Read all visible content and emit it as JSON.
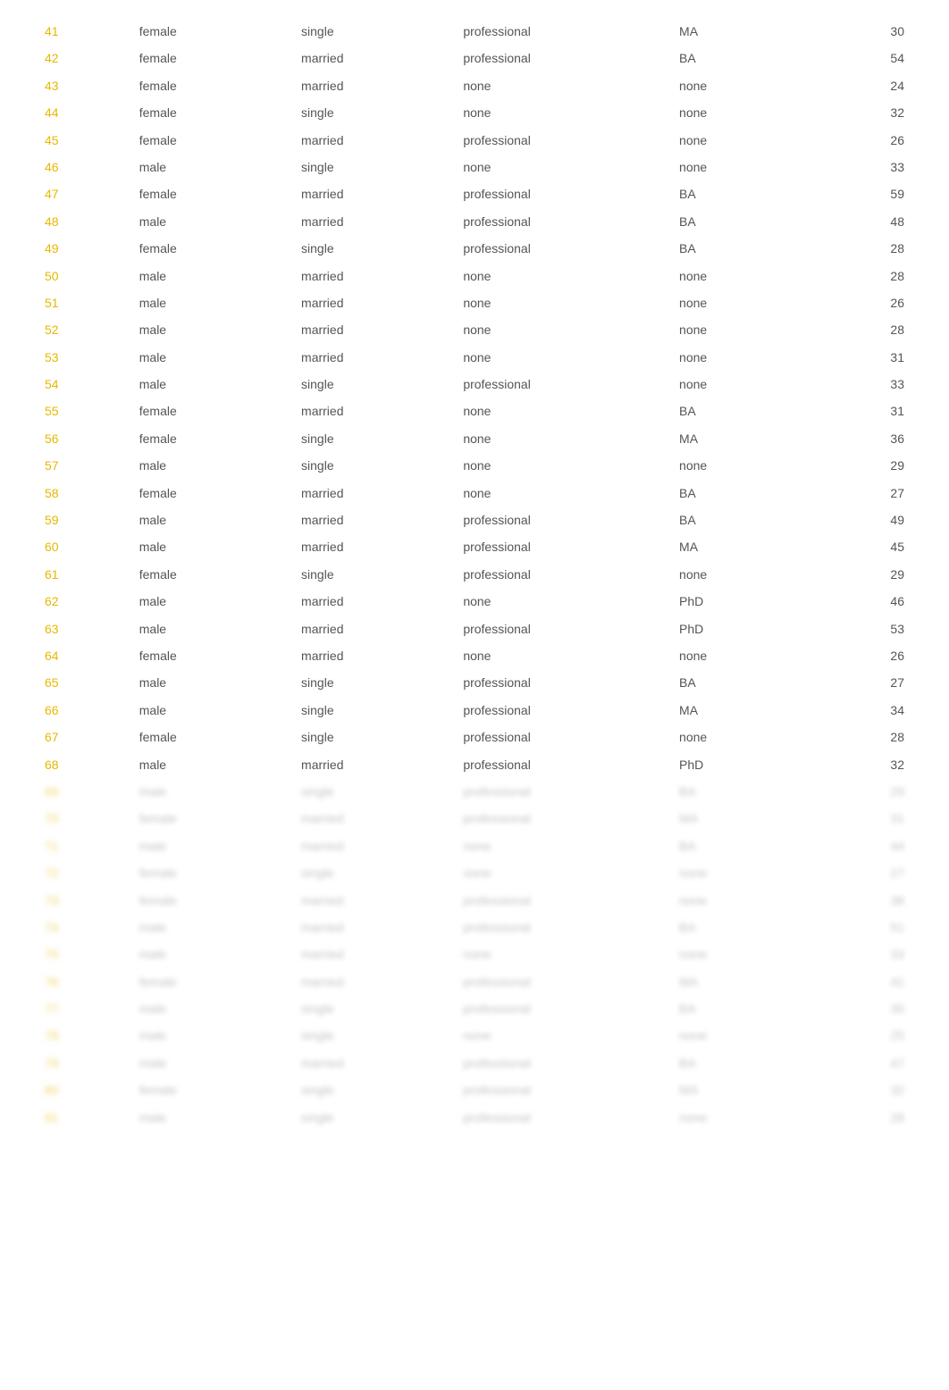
{
  "table": {
    "rows": [
      {
        "id": "41",
        "gender": "female",
        "marital": "single",
        "job": "professional",
        "edu": "MA",
        "age": "30"
      },
      {
        "id": "42",
        "gender": "female",
        "marital": "married",
        "job": "professional",
        "edu": "BA",
        "age": "54"
      },
      {
        "id": "43",
        "gender": "female",
        "marital": "married",
        "job": "none",
        "edu": "none",
        "age": "24"
      },
      {
        "id": "44",
        "gender": "female",
        "marital": "single",
        "job": "none",
        "edu": "none",
        "age": "32"
      },
      {
        "id": "45",
        "gender": "female",
        "marital": "married",
        "job": "professional",
        "edu": "none",
        "age": "26"
      },
      {
        "id": "46",
        "gender": "male",
        "marital": "single",
        "job": "none",
        "edu": "none",
        "age": "33"
      },
      {
        "id": "47",
        "gender": "female",
        "marital": "married",
        "job": "professional",
        "edu": "BA",
        "age": "59"
      },
      {
        "id": "48",
        "gender": "male",
        "marital": "married",
        "job": "professional",
        "edu": "BA",
        "age": "48"
      },
      {
        "id": "49",
        "gender": "female",
        "marital": "single",
        "job": "professional",
        "edu": "BA",
        "age": "28"
      },
      {
        "id": "50",
        "gender": "male",
        "marital": "married",
        "job": "none",
        "edu": "none",
        "age": "28"
      },
      {
        "id": "51",
        "gender": "male",
        "marital": "married",
        "job": "none",
        "edu": "none",
        "age": "26"
      },
      {
        "id": "52",
        "gender": "male",
        "marital": "married",
        "job": "none",
        "edu": "none",
        "age": "28"
      },
      {
        "id": "53",
        "gender": "male",
        "marital": "married",
        "job": "none",
        "edu": "none",
        "age": "31"
      },
      {
        "id": "54",
        "gender": "male",
        "marital": "single",
        "job": "professional",
        "edu": "none",
        "age": "33"
      },
      {
        "id": "55",
        "gender": "female",
        "marital": "married",
        "job": "none",
        "edu": "BA",
        "age": "31"
      },
      {
        "id": "56",
        "gender": "female",
        "marital": "single",
        "job": "none",
        "edu": "MA",
        "age": "36"
      },
      {
        "id": "57",
        "gender": "male",
        "marital": "single",
        "job": "none",
        "edu": "none",
        "age": "29"
      },
      {
        "id": "58",
        "gender": "female",
        "marital": "married",
        "job": "none",
        "edu": "BA",
        "age": "27"
      },
      {
        "id": "59",
        "gender": "male",
        "marital": "married",
        "job": "professional",
        "edu": "BA",
        "age": "49"
      },
      {
        "id": "60",
        "gender": "male",
        "marital": "married",
        "job": "professional",
        "edu": "MA",
        "age": "45"
      },
      {
        "id": "61",
        "gender": "female",
        "marital": "single",
        "job": "professional",
        "edu": "none",
        "age": "29"
      },
      {
        "id": "62",
        "gender": "male",
        "marital": "married",
        "job": "none",
        "edu": "PhD",
        "age": "46"
      },
      {
        "id": "63",
        "gender": "male",
        "marital": "married",
        "job": "professional",
        "edu": "PhD",
        "age": "53"
      },
      {
        "id": "64",
        "gender": "female",
        "marital": "married",
        "job": "none",
        "edu": "none",
        "age": "26"
      },
      {
        "id": "65",
        "gender": "male",
        "marital": "single",
        "job": "professional",
        "edu": "BA",
        "age": "27"
      },
      {
        "id": "66",
        "gender": "male",
        "marital": "single",
        "job": "professional",
        "edu": "MA",
        "age": "34"
      },
      {
        "id": "67",
        "gender": "female",
        "marital": "single",
        "job": "professional",
        "edu": "none",
        "age": "28"
      },
      {
        "id": "68",
        "gender": "male",
        "marital": "married",
        "job": "professional",
        "edu": "PhD",
        "age": "32"
      }
    ],
    "blurred_rows": [
      {
        "id": "69",
        "gender": "male",
        "marital": "single",
        "job": "professional",
        "edu": "BA",
        "age": "29"
      },
      {
        "id": "70",
        "gender": "female",
        "marital": "married",
        "job": "professional",
        "edu": "MA",
        "age": "31"
      },
      {
        "id": "71",
        "gender": "male",
        "marital": "married",
        "job": "none",
        "edu": "BA",
        "age": "44"
      },
      {
        "id": "72",
        "gender": "female",
        "marital": "single",
        "job": "none",
        "edu": "none",
        "age": "27"
      },
      {
        "id": "73",
        "gender": "female",
        "marital": "married",
        "job": "professional",
        "edu": "none",
        "age": "38"
      },
      {
        "id": "74",
        "gender": "male",
        "marital": "married",
        "job": "professional",
        "edu": "BA",
        "age": "51"
      },
      {
        "id": "75",
        "gender": "male",
        "marital": "married",
        "job": "none",
        "edu": "none",
        "age": "33"
      },
      {
        "id": "76",
        "gender": "female",
        "marital": "married",
        "job": "professional",
        "edu": "MA",
        "age": "41"
      },
      {
        "id": "77",
        "gender": "male",
        "marital": "single",
        "job": "professional",
        "edu": "BA",
        "age": "30"
      },
      {
        "id": "78",
        "gender": "male",
        "marital": "single",
        "job": "none",
        "edu": "none",
        "age": "25"
      },
      {
        "id": "79",
        "gender": "male",
        "marital": "married",
        "job": "professional",
        "edu": "BA",
        "age": "47"
      },
      {
        "id": "80",
        "gender": "female",
        "marital": "single",
        "job": "professional",
        "edu": "MA",
        "age": "32"
      },
      {
        "id": "81",
        "gender": "male",
        "marital": "single",
        "job": "professional",
        "edu": "none",
        "age": "28"
      }
    ]
  }
}
